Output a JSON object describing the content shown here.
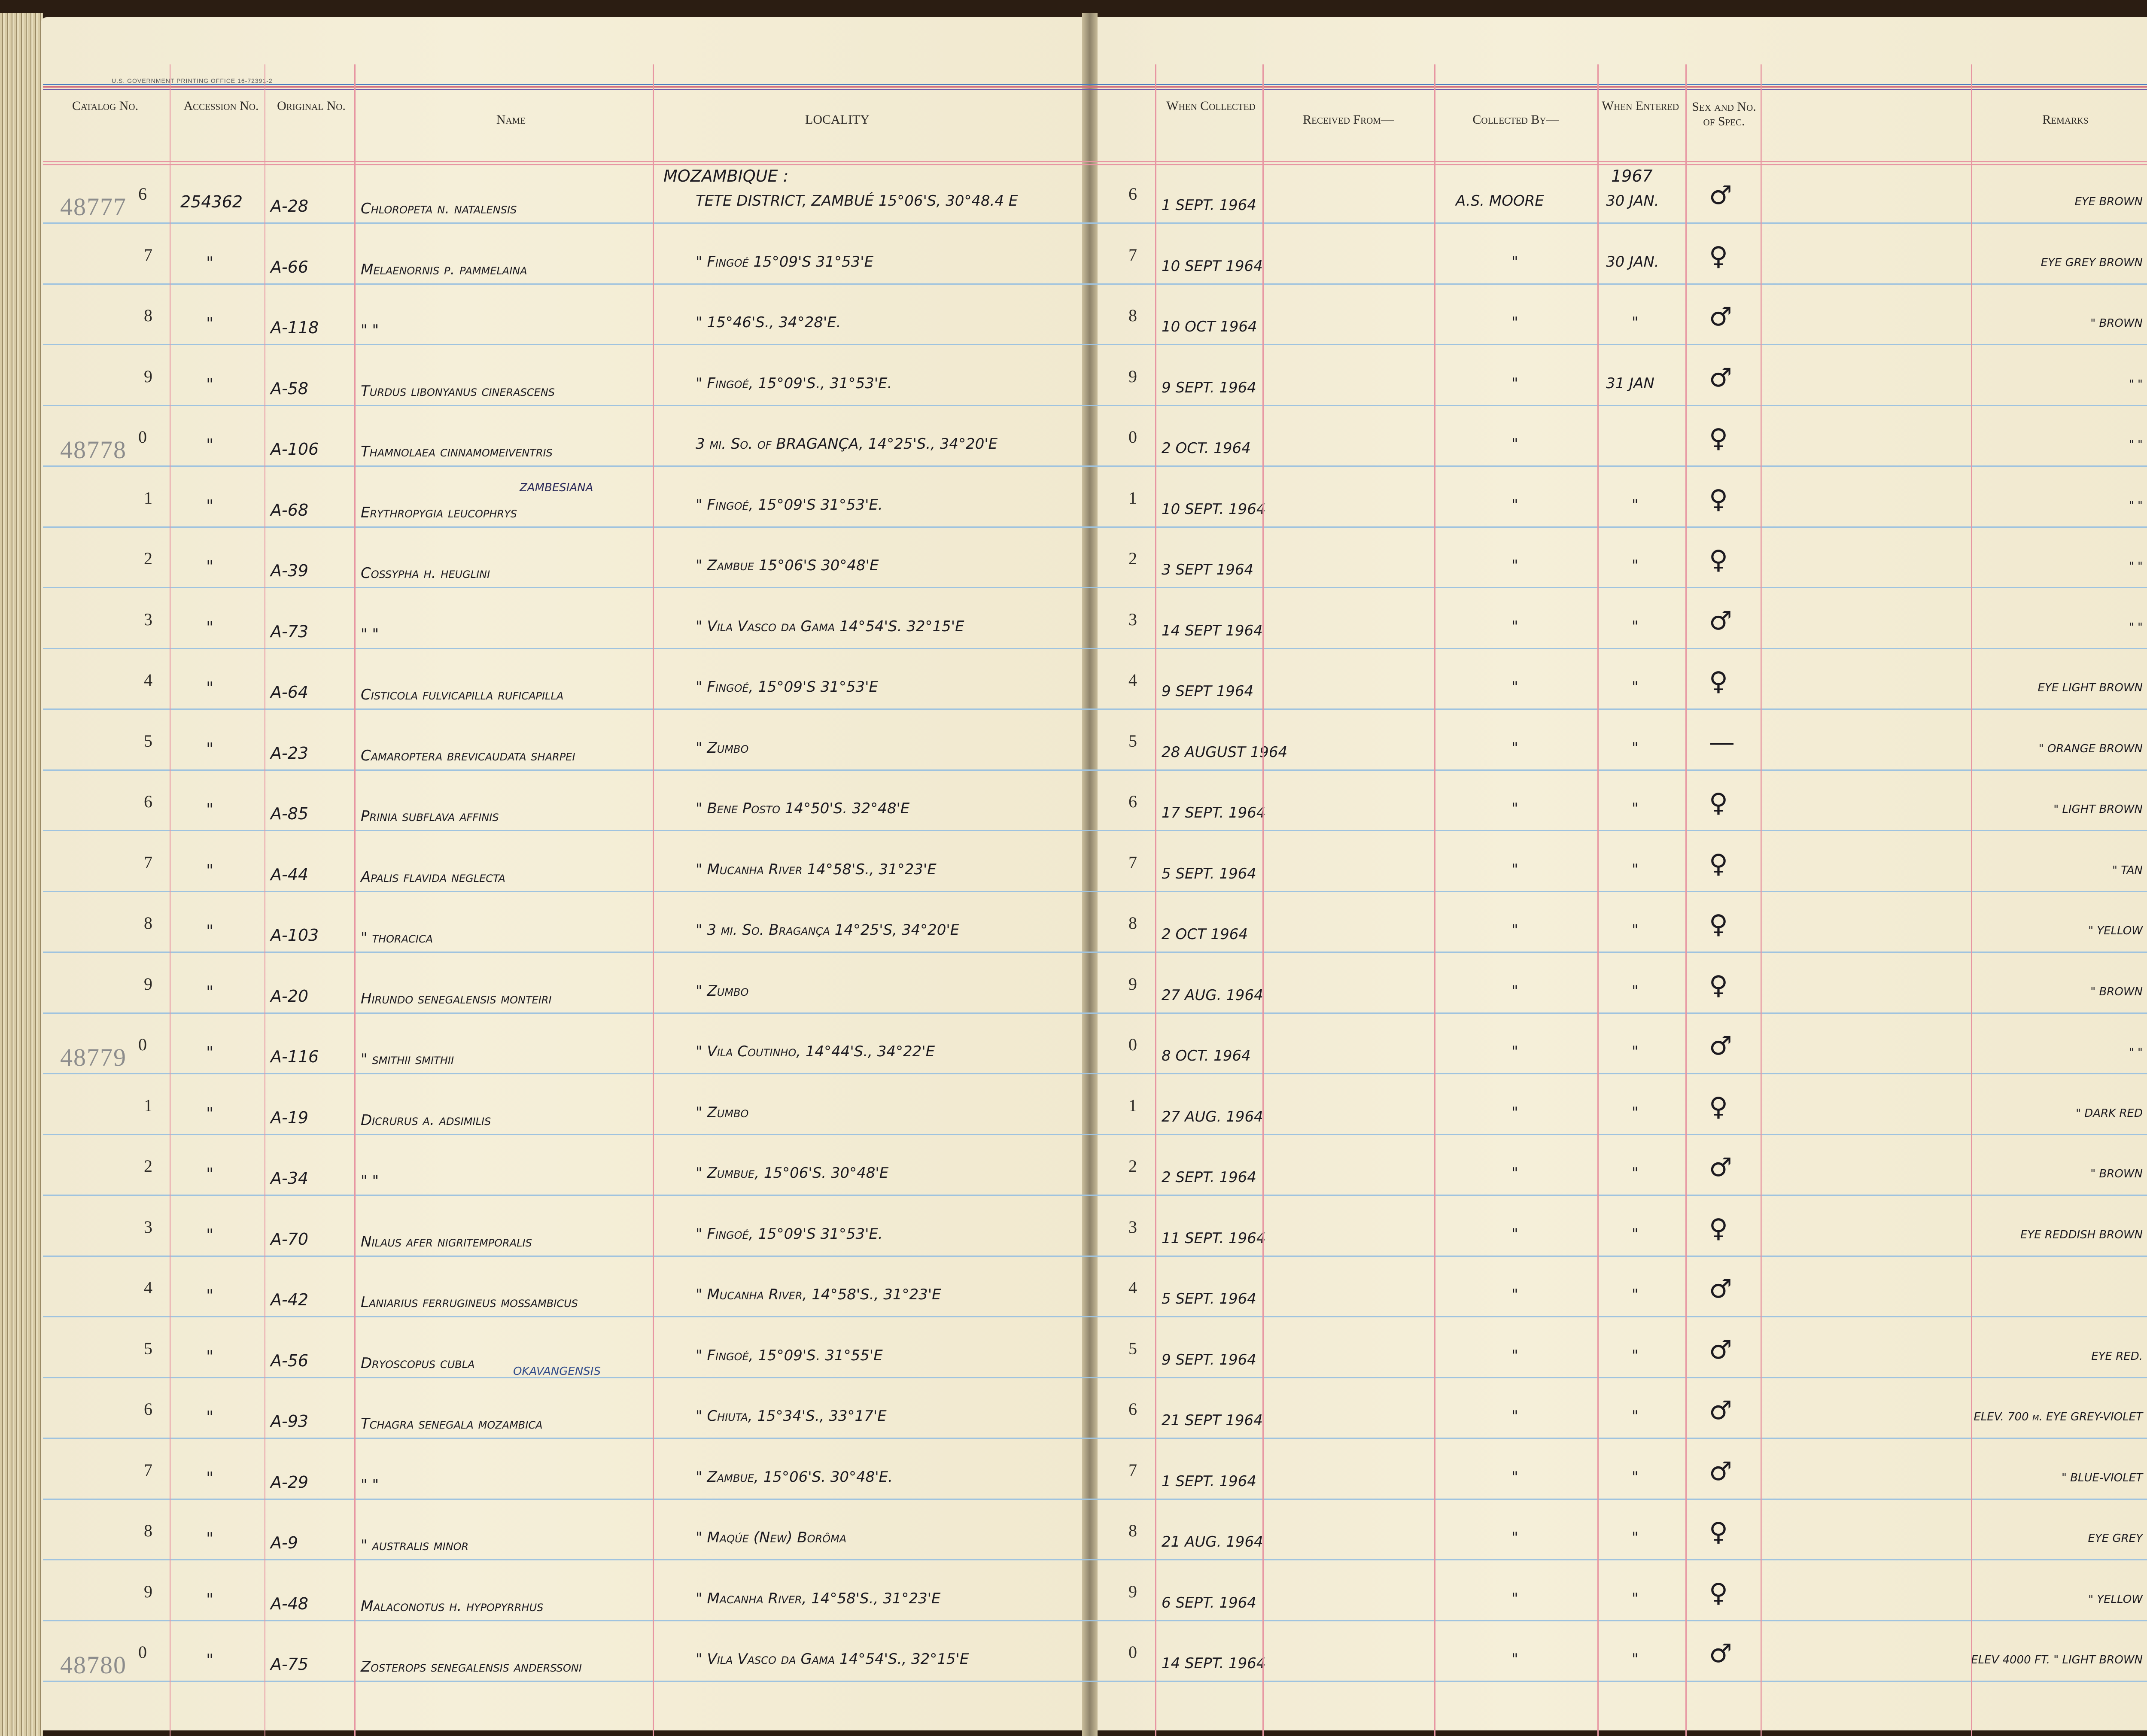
{
  "header": {
    "printer_note": "U.S. GOVERNMENT PRINTING OFFICE   16-72391-2",
    "columns": {
      "catalog_no": "Catalog No.",
      "accession_no": "Accession No.",
      "original_no": "Original No.",
      "name": "Name",
      "locality": "LOCALITY",
      "when_collected": "When Collected",
      "received_from": "Received From—",
      "collected_by": "Collected By—",
      "when_entered": "When Entered",
      "sex": "Sex and No. of Spec.",
      "remarks": "Remarks"
    }
  },
  "section_heading": "MOZAMBIQUE :",
  "year_entered": "1967",
  "catalog_stamps": [
    "48777",
    "48778",
    "48779",
    "48780"
  ],
  "rows": [
    {
      "digit": "6",
      "stamp": "48777",
      "accession": "254362",
      "orig": "A-28",
      "name": "Chloropeta n. natalensis",
      "name_note": "",
      "locality": "TETE DISTRICT, ZAMBUÉ 15°06'S, 30°48.4 E",
      "row_mark": "6",
      "collected": "1 SEPT. 1964",
      "collector": "A.S. MOORE",
      "entered": "30 JAN.",
      "sex": "♂",
      "remarks": "EYE BROWN"
    },
    {
      "digit": "7",
      "stamp": "",
      "accession": "\"",
      "orig": "A-66",
      "name": "Melaenornis p. pammelaina",
      "name_note": "",
      "locality": "\"          Fingoé 15°09'S 31°53'E",
      "row_mark": "7",
      "collected": "10 SEPT 1964",
      "collector": "\"",
      "entered": "30 JAN.",
      "sex": "♀",
      "remarks": "EYE GREY BROWN"
    },
    {
      "digit": "8",
      "stamp": "",
      "accession": "\"",
      "orig": "A-118",
      "name": "  \"          \"",
      "name_note": "",
      "locality": "\"          15°46'S., 34°28'E.",
      "row_mark": "8",
      "collected": "10 OCT 1964",
      "collector": "\"",
      "entered": "\"",
      "sex": "♂",
      "remarks": "\" BROWN"
    },
    {
      "digit": "9",
      "stamp": "",
      "accession": "\"",
      "orig": "A-58",
      "name": "Turdus libonyanus cinerascens",
      "name_note": "",
      "locality": "\"  Fingoé, 15°09'S., 31°53'E.",
      "row_mark": "9",
      "collected": "9 SEPT. 1964",
      "collector": "\"",
      "entered": "31 JAN",
      "sex": "♂",
      "remarks": "\"   \""
    },
    {
      "digit": "0",
      "stamp": "48778",
      "accession": "\"",
      "orig": "A-106",
      "name": "Thamnolaea cinnamomeiventris",
      "name_note": "",
      "locality": "3 mi. So. of BRAGANÇA, 14°25'S., 34°20'E",
      "row_mark": "0",
      "collected": "2 OCT. 1964",
      "collector": "\"",
      "entered": "",
      "sex": "♀",
      "remarks": "\"   \""
    },
    {
      "digit": "1",
      "stamp": "",
      "accession": "\"",
      "orig": "A-68",
      "name": "Erythropygia leucophrys",
      "name_note": "ZAMBESIANA",
      "locality": "\" Fingoé, 15°09'S 31°53'E.",
      "row_mark": "1",
      "collected": "10 SEPT. 1964",
      "collector": "\"",
      "entered": "\"",
      "sex": "♀",
      "remarks": "\"   \""
    },
    {
      "digit": "2",
      "stamp": "",
      "accession": "\"",
      "orig": "A-39",
      "name": "Cossypha h. heuglini",
      "name_note": "",
      "locality": "\" Zambue 15°06'S 30°48'E",
      "row_mark": "2",
      "collected": "3 SEPT 1964",
      "collector": "\"",
      "entered": "\"",
      "sex": "♀",
      "remarks": "\"   \""
    },
    {
      "digit": "3",
      "stamp": "",
      "accession": "\"",
      "orig": "A-73",
      "name": "   \"        \"",
      "name_note": "",
      "locality": "\" Vila Vasco da Gama 14°54'S. 32°15'E",
      "row_mark": "3",
      "collected": "14 SEPT 1964",
      "collector": "\"",
      "entered": "\"",
      "sex": "♂",
      "remarks": "\"   \""
    },
    {
      "digit": "4",
      "stamp": "",
      "accession": "\"",
      "orig": "A-64",
      "name": "Cisticola fulvicapilla ruficapilla",
      "name_note": "",
      "locality": "\" Fingoé, 15°09'S 31°53'E",
      "row_mark": "4",
      "collected": "9 SEPT 1964",
      "collector": "\"",
      "entered": "\"",
      "sex": "♀",
      "remarks": "EYE LIGHT BROWN"
    },
    {
      "digit": "5",
      "stamp": "",
      "accession": "\"",
      "orig": "A-23",
      "name": "Camaroptera brevicaudata sharpei",
      "name_note": "",
      "locality": "\" Zumbo",
      "row_mark": "5",
      "collected": "28 AUGUST 1964",
      "collector": "\"",
      "entered": "\"",
      "sex": "—",
      "remarks": "\" ORANGE BROWN"
    },
    {
      "digit": "6",
      "stamp": "",
      "accession": "\"",
      "orig": "A-85",
      "name": "Prinia subflava affinis",
      "name_note": "",
      "locality": "\" Bene Posto 14°50'S. 32°48'E",
      "row_mark": "6",
      "collected": "17 SEPT. 1964",
      "collector": "\"",
      "entered": "\"",
      "sex": "♀",
      "remarks": "\" LIGHT BROWN"
    },
    {
      "digit": "7",
      "stamp": "",
      "accession": "\"",
      "orig": "A-44",
      "name": "Apalis flavida neglecta",
      "name_note": "",
      "locality": "\" Mucanha River 14°58'S., 31°23'E",
      "row_mark": "7",
      "collected": "5 SEPT. 1964",
      "collector": "\"",
      "entered": "\"",
      "sex": "♀",
      "remarks": "\" TAN"
    },
    {
      "digit": "8",
      "stamp": "",
      "accession": "\"",
      "orig": "A-103",
      "name": "  \"  thoracica",
      "name_note": "",
      "locality": "\" 3 mi. So. Bragança 14°25'S, 34°20'E",
      "row_mark": "8",
      "collected": "2 OCT 1964",
      "collector": "\"",
      "entered": "\"",
      "sex": "♀",
      "remarks": "\" YELLOW"
    },
    {
      "digit": "9",
      "stamp": "",
      "accession": "\"",
      "orig": "A-20",
      "name": "Hirundo senegalensis monteiri",
      "name_note": "",
      "locality": "\" Zumbo",
      "row_mark": "9",
      "collected": "27 AUG. 1964",
      "collector": "\"",
      "entered": "\"",
      "sex": "♀",
      "remarks": "\" BROWN"
    },
    {
      "digit": "0",
      "stamp": "48779",
      "accession": "\"",
      "orig": "A-116",
      "name": "  \" smithii smithii",
      "name_note": "",
      "locality": "\" Vila Coutinho, 14°44'S., 34°22'E",
      "row_mark": "0",
      "collected": "8 OCT. 1964",
      "collector": "\"",
      "entered": "\"",
      "sex": "♂",
      "remarks": "\"  \""
    },
    {
      "digit": "1",
      "stamp": "",
      "accession": "\"",
      "orig": "A-19",
      "name": "Dicrurus a. adsimilis",
      "name_note": "",
      "locality": "\" Zumbo",
      "row_mark": "1",
      "collected": "27 AUG. 1964",
      "collector": "\"",
      "entered": "\"",
      "sex": "♀",
      "remarks": "\" DARK RED"
    },
    {
      "digit": "2",
      "stamp": "",
      "accession": "\"",
      "orig": "A-34",
      "name": "   \"        \"",
      "name_note": "",
      "locality": "\" Zumbue, 15°06'S. 30°48'E",
      "row_mark": "2",
      "collected": "2 SEPT. 1964",
      "collector": "\"",
      "entered": "\"",
      "sex": "♂",
      "remarks": "\" BROWN"
    },
    {
      "digit": "3",
      "stamp": "",
      "accession": "\"",
      "orig": "A-70",
      "name": "Nilaus afer nigritemporalis",
      "name_note": "",
      "locality": "\" Fingoé, 15°09'S 31°53'E.",
      "row_mark": "3",
      "collected": "11 SEPT. 1964",
      "collector": "\"",
      "entered": "\"",
      "sex": "♀",
      "remarks": "EYE REDDISH BROWN"
    },
    {
      "digit": "4",
      "stamp": "",
      "accession": "\"",
      "orig": "A-42",
      "name": "Laniarius ferrugineus mossambicus",
      "name_note": "",
      "locality": "\" Mucanha River, 14°58'S., 31°23'E",
      "row_mark": "4",
      "collected": "5 SEPT. 1964",
      "collector": "\"",
      "entered": "\"",
      "sex": "♂",
      "remarks": ""
    },
    {
      "digit": "5",
      "stamp": "",
      "accession": "\"",
      "orig": "A-56",
      "name": "Dryoscopus cubla",
      "name_note": "OKAVANGENSIS",
      "locality": "\" Fingoé, 15°09'S. 31°55'E",
      "row_mark": "5",
      "collected": "9 SEPT. 1964",
      "collector": "\"",
      "entered": "\"",
      "sex": "♂",
      "remarks": "EYE RED."
    },
    {
      "digit": "6",
      "stamp": "",
      "accession": "\"",
      "orig": "A-93",
      "name": "Tchagra senegala mozambica",
      "name_note": "",
      "locality": "\" Chiuta, 15°34'S., 33°17'E",
      "row_mark": "6",
      "collected": "21 SEPT 1964",
      "collector": "\"",
      "entered": "\"",
      "sex": "♂",
      "remarks": "ELEV. 700 m. EYE GREY-VIOLET"
    },
    {
      "digit": "7",
      "stamp": "",
      "accession": "\"",
      "orig": "A-29",
      "name": "   \"        \"",
      "name_note": "",
      "locality": "\" Zambue, 15°06'S. 30°48'E.",
      "row_mark": "7",
      "collected": "1 SEPT. 1964",
      "collector": "\"",
      "entered": "\"",
      "sex": "♂",
      "remarks": "\" BLUE-VIOLET"
    },
    {
      "digit": "8",
      "stamp": "",
      "accession": "\"",
      "orig": "A-9",
      "name": "  \" australis minor",
      "name_note": "",
      "locality": "\" Maqúe (New) Borôma",
      "row_mark": "8",
      "collected": "21 AUG. 1964",
      "collector": "\"",
      "entered": "\"",
      "sex": "♀",
      "remarks": "EYE GREY"
    },
    {
      "digit": "9",
      "stamp": "",
      "accession": "\"",
      "orig": "A-48",
      "name": "Malaconotus h. hypopyrrhus",
      "name_note": "",
      "locality": "\" Macanha River, 14°58'S., 31°23'E",
      "row_mark": "9",
      "collected": "6 SEPT. 1964",
      "collector": "\"",
      "entered": "\"",
      "sex": "♀",
      "remarks": "\" YELLOW"
    },
    {
      "digit": "0",
      "stamp": "48780",
      "accession": "\"",
      "orig": "A-75",
      "name": "Zosterops senegalensis anderssoni",
      "name_note": "",
      "locality": "\" Vila Vasco da Gama 14°54'S., 32°15'E",
      "row_mark": "0",
      "collected": "14 SEPT. 1964",
      "collector": "\"",
      "entered": "\"",
      "sex": "♂",
      "remarks": "ELEV 4000 FT. \" LIGHT BROWN"
    }
  ]
}
